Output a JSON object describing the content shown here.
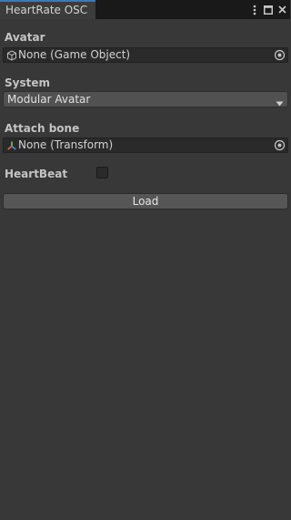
{
  "window": {
    "tab_title": "HeartRate OSC"
  },
  "fields": {
    "avatar": {
      "label": "Avatar",
      "value": "None (Game Object)",
      "icon": "gameobject-cube-icon"
    },
    "system": {
      "label": "System",
      "value": "Modular Avatar"
    },
    "attach_bone": {
      "label": "Attach bone",
      "value": "None (Transform)",
      "icon": "transform-axes-icon"
    },
    "heartbeat": {
      "label": "HeartBeat",
      "checked": false
    }
  },
  "actions": {
    "load_label": "Load"
  },
  "colors": {
    "background": "#383838",
    "tab_accent": "#3a79bb",
    "field_bg": "#2a2a2a",
    "button_bg": "#565656"
  }
}
